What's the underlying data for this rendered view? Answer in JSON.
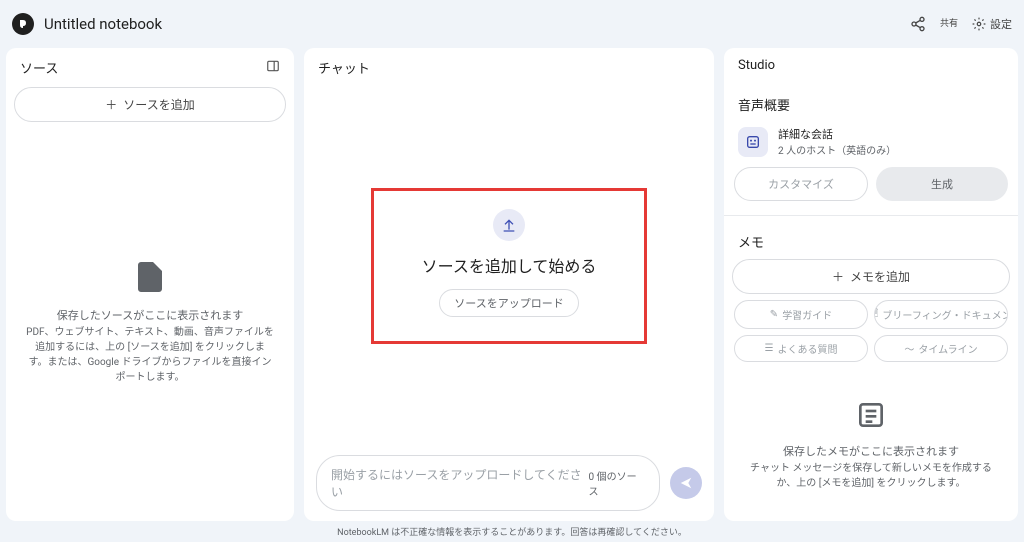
{
  "header": {
    "title": "Untitled notebook",
    "share_label": "共有",
    "settings_label": "設定"
  },
  "sources": {
    "panel_title": "ソース",
    "add_button": "ソースを追加",
    "empty_title": "保存したソースがここに表示されます",
    "empty_desc": "PDF、ウェブサイト、テキスト、動画、音声ファイルを追加するには、上の [ソースを追加] をクリックします。または、Google ドライブからファイルを直接インポートします。"
  },
  "chat": {
    "panel_title": "チャット",
    "center_heading": "ソースを追加して始める",
    "upload_button": "ソースをアップロード",
    "input_placeholder": "開始するにはソースをアップロードしてください",
    "source_count": "0 個のソース"
  },
  "studio": {
    "panel_title": "Studio",
    "audio_section": "音声概要",
    "audio_title": "詳細な会話",
    "audio_subtitle": "2 人のホスト（英語のみ）",
    "customize_btn": "カスタマイズ",
    "generate_btn": "生成",
    "memo_section": "メモ",
    "add_memo_btn": "メモを追加",
    "memo_buttons": [
      "学習ガイド",
      "ブリーフィング・ドキュメン",
      "よくある質問",
      "タイムライン"
    ],
    "empty_memo_title": "保存したメモがここに表示されます",
    "empty_memo_desc": "チャット メッセージを保存して新しいメモを作成するか、上の [メモを追加] をクリックします。"
  },
  "footer": "NotebookLM は不正確な情報を表示することがあります。回答は再確認してください。"
}
